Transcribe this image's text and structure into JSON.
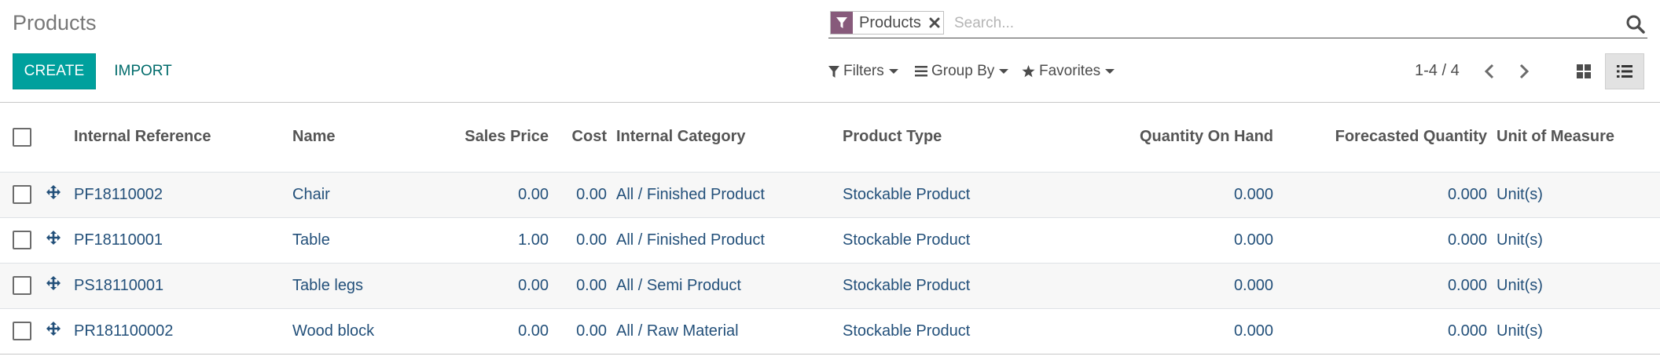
{
  "page": {
    "title": "Products"
  },
  "actions": {
    "create_label": "CREATE",
    "import_label": "IMPORT"
  },
  "search": {
    "facet_label": "Products",
    "placeholder": "Search...",
    "facet_icon": "filter-icon",
    "remove_icon": "close-icon",
    "search_icon": "search-icon"
  },
  "filters": {
    "filters_label": "Filters",
    "groupby_label": "Group By",
    "favorites_label": "Favorites"
  },
  "pager": {
    "value": "1-4 / 4"
  },
  "views": {
    "kanban_icon": "kanban-view-icon",
    "list_icon": "list-view-icon",
    "active": "list"
  },
  "colors": {
    "accent": "#00a09d",
    "facet": "#875a7b",
    "link": "#23507a"
  },
  "table": {
    "columns": [
      "Internal Reference",
      "Name",
      "Sales Price",
      "Cost",
      "Internal Category",
      "Product Type",
      "Quantity On Hand",
      "Forecasted Quantity",
      "Unit of Measure"
    ],
    "rows": [
      {
        "ref": "PF18110002",
        "name": "Chair",
        "sales_price": "0.00",
        "cost": "0.00",
        "category": "All / Finished Product",
        "type": "Stockable Product",
        "qty_on_hand": "0.000",
        "forecast": "0.000",
        "uom": "Unit(s)"
      },
      {
        "ref": "PF18110001",
        "name": "Table",
        "sales_price": "1.00",
        "cost": "0.00",
        "category": "All / Finished Product",
        "type": "Stockable Product",
        "qty_on_hand": "0.000",
        "forecast": "0.000",
        "uom": "Unit(s)"
      },
      {
        "ref": "PS18110001",
        "name": "Table legs",
        "sales_price": "0.00",
        "cost": "0.00",
        "category": "All / Semi Product",
        "type": "Stockable Product",
        "qty_on_hand": "0.000",
        "forecast": "0.000",
        "uom": "Unit(s)"
      },
      {
        "ref": "PR181100002",
        "name": "Wood block",
        "sales_price": "0.00",
        "cost": "0.00",
        "category": "All / Raw Material",
        "type": "Stockable Product",
        "qty_on_hand": "0.000",
        "forecast": "0.000",
        "uom": "Unit(s)"
      }
    ]
  }
}
